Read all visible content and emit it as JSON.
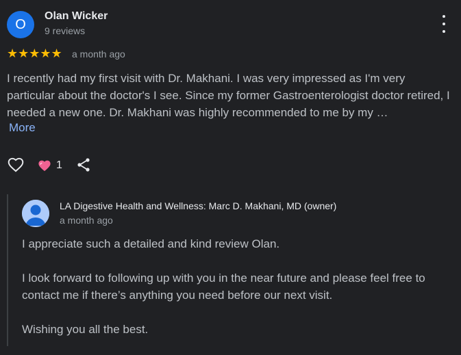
{
  "reviewer": {
    "initial": "O",
    "name": "Olan Wicker",
    "reviews": "9 reviews",
    "avatar_color": "#1a73e8"
  },
  "review": {
    "stars": "★★★★★",
    "date": "a month ago",
    "text": "I recently had my first visit with Dr. Makhani. I was very impressed as I'm very particular about the doctor's I see. Since my former Gastroenterologist doctor retired, I needed a new one. Dr. Makhani was highly recommended to me by my …",
    "more_label": "More"
  },
  "actions": {
    "like_icon": "heart-outline-icon",
    "reaction_icon": "pink-heart-icon",
    "reaction_count": "1",
    "share_icon": "share-icon"
  },
  "owner_reply": {
    "name": "LA Digestive Health and Wellness: Marc D. Makhani, MD (owner)",
    "date": "a month ago",
    "paragraphs": [
      "I appreciate such a detailed and kind review Olan.",
      "I look forward to following up with you in the near future and please feel free to contact me if there’s anything you need before our next visit.",
      "Wishing you all the best."
    ]
  },
  "colors": {
    "background": "#202124",
    "star": "#fbbc04",
    "link": "#8ab4f8"
  }
}
